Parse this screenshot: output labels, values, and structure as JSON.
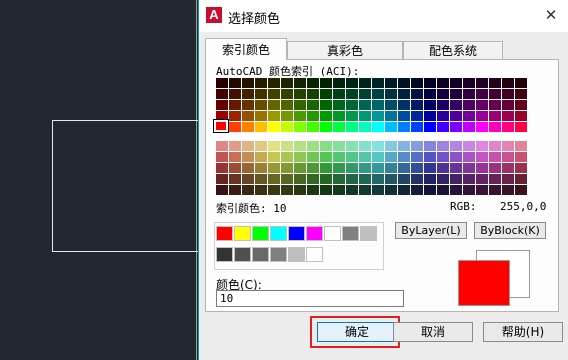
{
  "dialog": {
    "title": "选择颜色",
    "close_symbol": "✕"
  },
  "tabs": [
    {
      "label": "索引颜色",
      "active": true
    },
    {
      "label": "真彩色",
      "active": false
    },
    {
      "label": "配色系统",
      "active": false
    }
  ],
  "aci": {
    "label": "AutoCAD 颜色索引 (ACI):",
    "index_text": "索引颜色: 10",
    "rgb_label": "RGB:",
    "rgb_value": "255,0,0"
  },
  "buttons": {
    "bylayer": "ByLayer(L)",
    "byblock": "ByBlock(K)",
    "ok": "确定",
    "cancel": "取消",
    "help": "帮助(H)"
  },
  "color_field": {
    "label": "颜色(C):",
    "value": "10"
  },
  "standard_colors": [
    "#ff0000",
    "#ffff00",
    "#00ff00",
    "#00ffff",
    "#0000ff",
    "#ff00ff",
    "#ffffff",
    "#808080",
    "#c0c0c0"
  ],
  "gray_colors": [
    "#333333",
    "#505050",
    "#696969",
    "#808080",
    "#bebebe",
    "#ffffff"
  ],
  "accent": {
    "selected_color": "#ff0000",
    "highlight": "#e02020",
    "dialog_border": "#00a2b0"
  }
}
